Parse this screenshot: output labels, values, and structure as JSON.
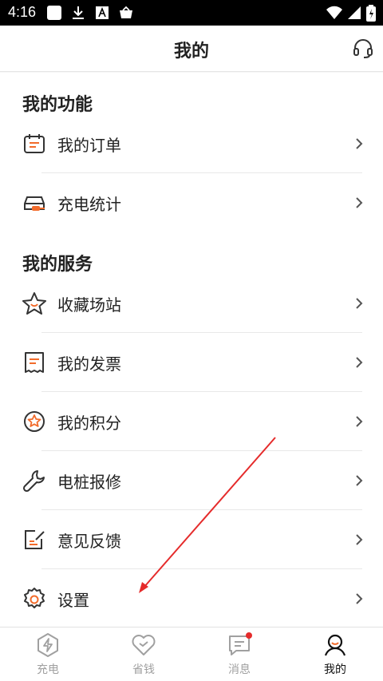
{
  "status_bar": {
    "time": "4:16"
  },
  "header": {
    "title": "我的",
    "support_icon": "headset-icon"
  },
  "sections": [
    {
      "title": "我的功能",
      "items": [
        {
          "label": "我的订单",
          "icon": "order-icon"
        },
        {
          "label": "充电统计",
          "icon": "car-charge-icon"
        }
      ]
    },
    {
      "title": "我的服务",
      "items": [
        {
          "label": "收藏场站",
          "icon": "star-icon"
        },
        {
          "label": "我的发票",
          "icon": "invoice-icon"
        },
        {
          "label": "我的积分",
          "icon": "points-icon"
        },
        {
          "label": "电桩报修",
          "icon": "wrench-icon"
        },
        {
          "label": "意见反馈",
          "icon": "feedback-icon"
        },
        {
          "label": "设置",
          "icon": "gear-icon"
        }
      ]
    }
  ],
  "tabs": [
    {
      "label": "充电",
      "icon": "charge-icon",
      "active": false
    },
    {
      "label": "省钱",
      "icon": "heart-icon",
      "active": false
    },
    {
      "label": "消息",
      "icon": "message-icon",
      "active": false,
      "badge": true
    },
    {
      "label": "我的",
      "icon": "profile-icon",
      "active": true
    }
  ],
  "colors": {
    "accent": "#f26b2b",
    "icon_dark": "#333333",
    "active_tab": "#111111",
    "inactive_tab": "#a0a0a0",
    "annotation": "#e52b2b"
  }
}
